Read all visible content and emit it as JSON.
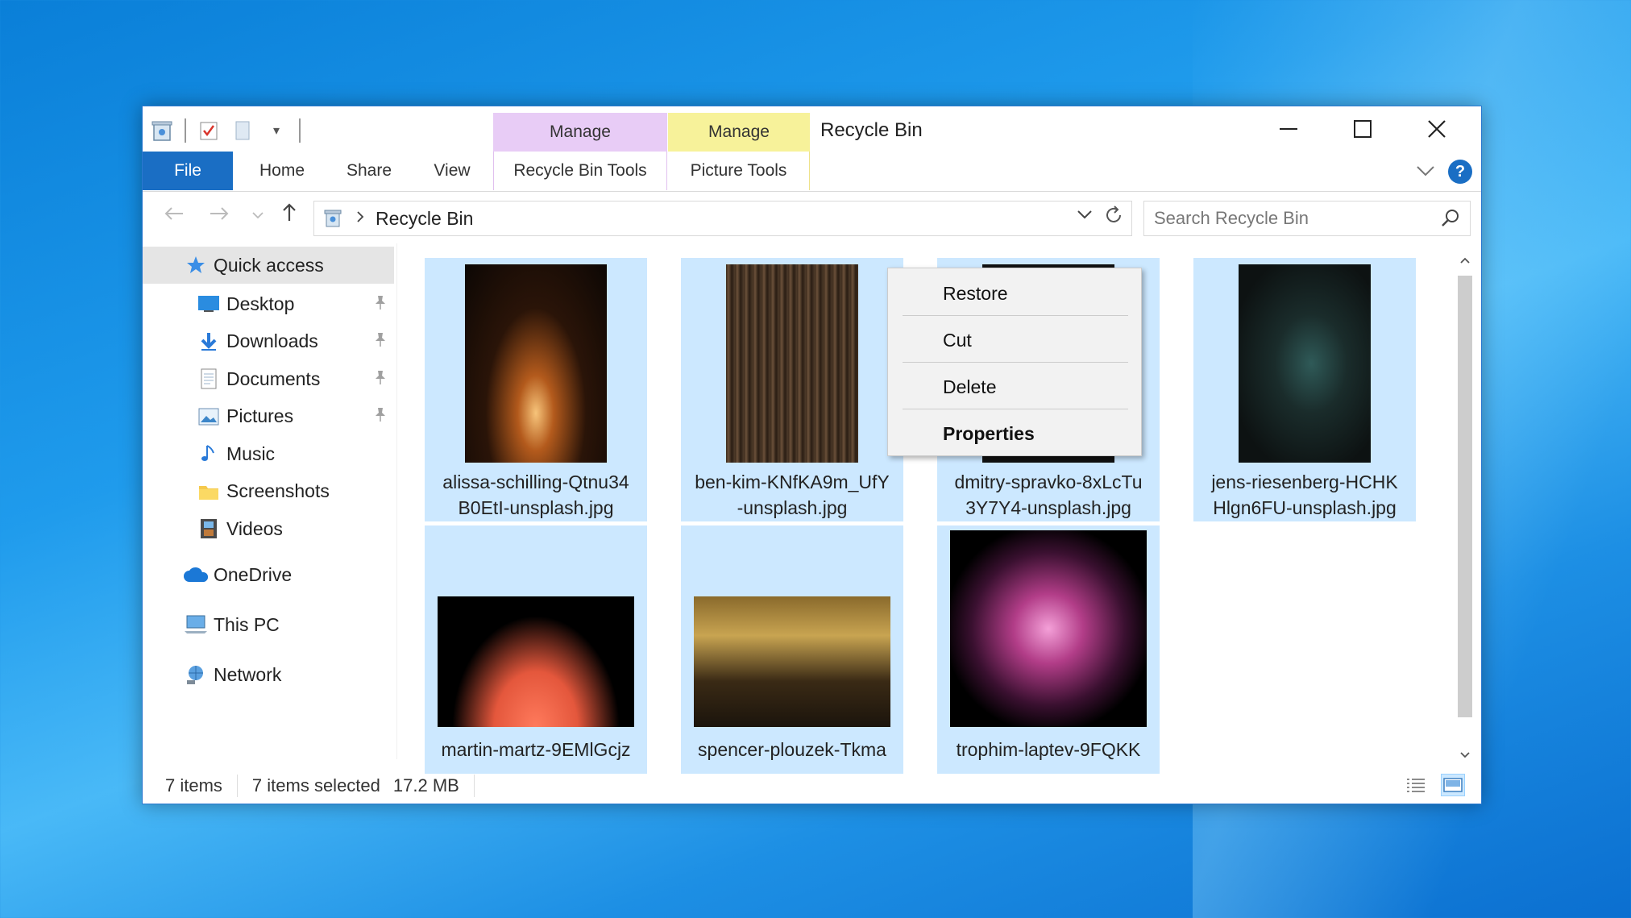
{
  "window": {
    "title": "Recycle Bin",
    "context_tabs": [
      {
        "label": "Manage",
        "sub_label": "Recycle Bin Tools",
        "color": "#e8ccf6"
      },
      {
        "label": "Manage",
        "sub_label": "Picture Tools",
        "color": "#f7f29a"
      }
    ],
    "controls": {
      "minimize": "—",
      "maximize": "",
      "close": "✕"
    }
  },
  "ribbon": {
    "tabs": [
      "File",
      "Home",
      "Share",
      "View"
    ],
    "file_color": "#1a6ec4",
    "help": "?"
  },
  "address": {
    "path": "Recycle Bin",
    "search_placeholder": "Search Recycle Bin"
  },
  "navpane": {
    "quick_access": "Quick access",
    "items": [
      {
        "label": "Desktop",
        "icon": "desktop-icon",
        "pinned": true
      },
      {
        "label": "Downloads",
        "icon": "downloads-icon",
        "pinned": true
      },
      {
        "label": "Documents",
        "icon": "documents-icon",
        "pinned": true
      },
      {
        "label": "Pictures",
        "icon": "pictures-icon",
        "pinned": true
      },
      {
        "label": "Music",
        "icon": "music-icon",
        "pinned": false
      },
      {
        "label": "Screenshots",
        "icon": "folder-icon",
        "pinned": false
      },
      {
        "label": "Videos",
        "icon": "videos-icon",
        "pinned": false
      }
    ],
    "onedrive": "OneDrive",
    "this_pc": "This PC",
    "network": "Network"
  },
  "files": [
    {
      "name_line1": "alissa-schilling-Qtnu34",
      "name_line2": "B0EtI-unsplash.jpg"
    },
    {
      "name_line1": "ben-kim-KNfKA9m_UfY",
      "name_line2": "-unsplash.jpg"
    },
    {
      "name_line1": "dmitry-spravko-8xLcTu",
      "name_line2": "3Y7Y4-unsplash.jpg"
    },
    {
      "name_line1": "jens-riesenberg-HCHK",
      "name_line2": "Hlgn6FU-unsplash.jpg"
    },
    {
      "name_line1": "martin-martz-9EMlGcjz",
      "name_line2": ""
    },
    {
      "name_line1": "spencer-plouzek-Tkma",
      "name_line2": ""
    },
    {
      "name_line1": "trophim-laptev-9FQKK",
      "name_line2": ""
    }
  ],
  "context_menu": {
    "items": [
      "Restore",
      "Cut",
      "Delete",
      "Properties"
    ]
  },
  "status": {
    "item_count": "7 items",
    "selected": "7 items selected",
    "size": "17.2 MB"
  },
  "colors": {
    "selection": "#cce8ff",
    "accent": "#1a6ec4"
  }
}
